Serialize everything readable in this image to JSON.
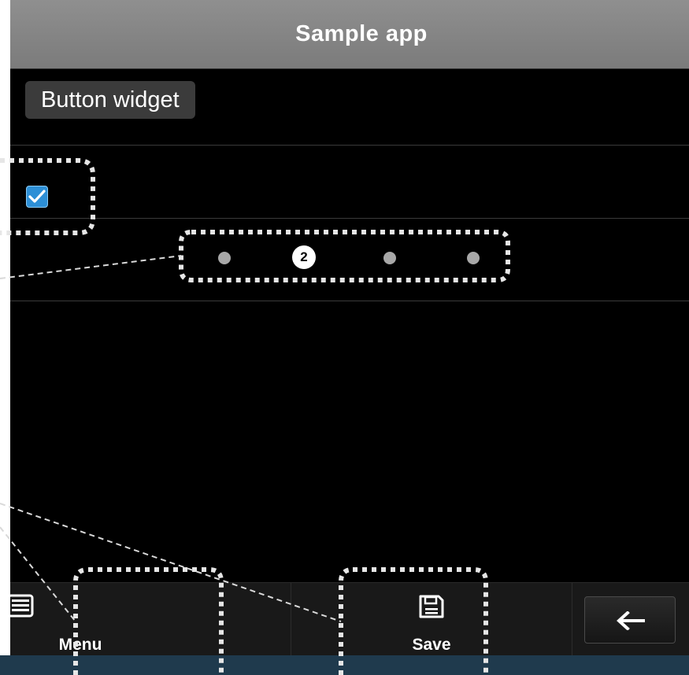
{
  "app": {
    "title": "Sample app"
  },
  "widgets": {
    "button_widget_label": "Button widget",
    "checkbox_checked": true
  },
  "pager": {
    "dot_count": 4,
    "active_page_label": "2"
  },
  "toolbar": {
    "menu_label": "Menu",
    "menu_icon": "list-icon",
    "save_label": "Save",
    "save_icon": "floppy-disk-icon",
    "back_icon": "arrow-left-icon"
  },
  "colors": {
    "title_bar": "#808080",
    "background": "#000000",
    "checkbox_accent": "#2d8fd6",
    "toolbar": "#191919"
  }
}
